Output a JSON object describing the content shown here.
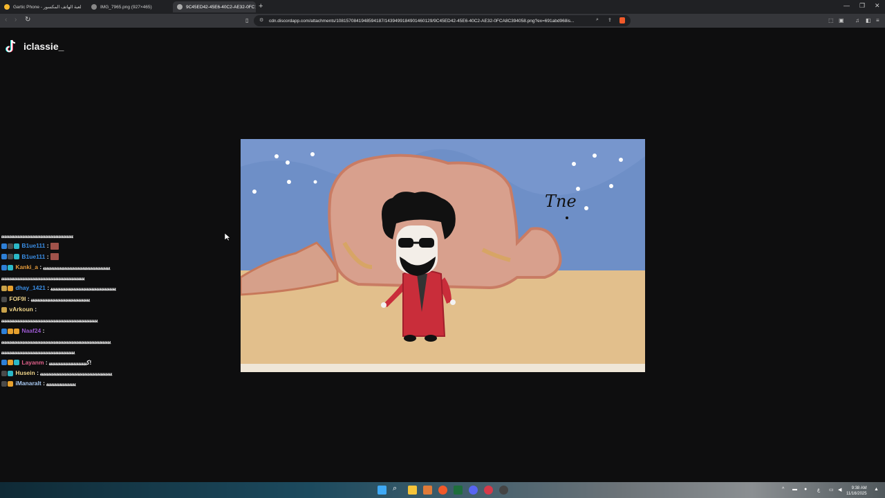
{
  "browser": {
    "tabs": [
      {
        "title": "Gartic Phone - لعبة الهاتف المكسور",
        "active": false
      },
      {
        "title": "IMG_7965.png (927×465)",
        "active": false
      },
      {
        "title": "9C45ED42-45E6-40C2-AE32-0FC",
        "active": true
      }
    ],
    "new_tab": "+",
    "url": "cdn.discordapp.com/attachments/1081570841948594187/1439499184901460129/9C45ED42-45E6-40C2-AE32-0FCA8C394058.png?ex=691abd968is..."
  },
  "stream": {
    "channel_name": "iclassie_"
  },
  "chat": [
    {
      "user": "",
      "color": "#ffffff",
      "badges": [],
      "message": "ﯾﯾﯾﯾﯾﯾﯾﯾﯾﯾﯾﯾﯾﯾﯾﯾﯾﯾﯾﯾﯾﯾﯾﯾﯾﯾﯾﯾﯾﯾﯾﯾﯾﯾﯾﯾﯾﯾﯾﯾﯾﯾﯾﯾ",
      "emote": false
    },
    {
      "user": "B1ue111",
      "color": "#3a8ee6",
      "badges": [
        "#2e7fd6",
        "#4a4a4a",
        "#2bb8c7"
      ],
      "message": "",
      "emote": true
    },
    {
      "user": "B1ue111",
      "color": "#3a8ee6",
      "badges": [
        "#2e7fd6",
        "#4a4a4a",
        "#2bb8c7"
      ],
      "message": "",
      "emote": true
    },
    {
      "user": "Kanki_a",
      "color": "#e39a3b",
      "badges": [
        "#2e7fd6",
        "#2bb8c7"
      ],
      "message": "ﯾﯾﯾﯾﯾﯾﯾﯾﯾﯾﯾﯾﯾﯾﯾﯾﯾﯾﯾﯾﯾﯾﯾﯾﯾﯾﯾﯾﯾﯾﯾﯾﯾﯾﯾﯾﯾﯾﯾﯾﯾ",
      "emote": false
    },
    {
      "user": "",
      "color": "#ffffff",
      "badges": [],
      "message": "ﯾﯾﯾﯾﯾﯾﯾﯾﯾﯾﯾﯾﯾﯾﯾﯾﯾﯾﯾﯾﯾﯾﯾﯾﯾﯾﯾﯾﯾﯾﯾﯾﯾﯾﯾﯾﯾﯾﯾﯾﯾﯾﯾﯾﯾﯾﯾﯾﯾﯾﯾ",
      "emote": false
    },
    {
      "user": "dhay_1421",
      "color": "#3a8ee6",
      "badges": [
        "#c9a24a",
        "#e6a02e"
      ],
      "message": "ﯾﯾﯾﯾﯾﯾﯾﯾﯾﯾﯾﯾﯾﯾﯾﯾﯾﯾﯾﯾﯾﯾﯾﯾﯾﯾﯾﯾﯾﯾﯾﯾﯾﯾﯾﯾﯾﯾﯾﯾ",
      "emote": false
    },
    {
      "user": "FOF9I",
      "color": "#f0d58a",
      "badges": [
        "#4a4a4a"
      ],
      "message": "ﯾﯾﯾﯾﯾﯾﯾﯾﯾﯾﯾﯾﯾﯾﯾﯾﯾﯾﯾﯾﯾﯾﯾﯾﯾﯾﯾﯾﯾﯾﯾﯾﯾﯾﯾﯾ",
      "emote": false
    },
    {
      "user": "vArkoun",
      "color": "#f0d58a",
      "badges": [
        "#c9a24a"
      ],
      "message": "",
      "emote": false
    },
    {
      "user": "",
      "color": "#ffffff",
      "badges": [],
      "message": "ﯾﯾﯾﯾﯾﯾﯾﯾﯾﯾﯾﯾﯾﯾﯾﯾﯾﯾﯾﯾﯾﯾﯾﯾﯾﯾﯾﯾﯾﯾﯾﯾﯾﯾﯾﯾﯾﯾﯾﯾﯾﯾﯾﯾﯾﯾﯾﯾﯾﯾﯾﯾﯾﯾﯾﯾﯾﯾﯾ",
      "emote": false
    },
    {
      "user": "Naaf24",
      "color": "#9b59d0",
      "badges": [
        "#2e7fd6",
        "#e6a02e",
        "#e6a02e"
      ],
      "message": "",
      "emote": false
    },
    {
      "user": "",
      "color": "#ffffff",
      "badges": [],
      "message": "ﯾﯾﯾﯾﯾﯾﯾﯾﯾﯾﯾﯾﯾﯾﯾﯾﯾﯾﯾﯾﯾﯾﯾﯾﯾﯾﯾﯾﯾﯾﯾﯾﯾﯾﯾﯾﯾﯾﯾﯾﯾﯾﯾﯾﯾﯾﯾﯾﯾﯾﯾﯾﯾﯾﯾﯾﯾﯾﯾﯾﯾﯾﯾﯾﯾﯾﯾ",
      "emote": false
    },
    {
      "user": "",
      "color": "#ffffff",
      "badges": [],
      "message": "ﯾﯾﯾﯾﯾﯾﯾﯾﯾﯾﯾﯾﯾﯾﯾﯾﯾﯾﯾﯾﯾﯾﯾﯾﯾﯾﯾﯾﯾﯾﯾﯾﯾﯾﯾﯾﯾﯾﯾﯾﯾﯾﯾﯾﯾ",
      "emote": false
    },
    {
      "user": "Layanm",
      "color": "#e0608a",
      "badges": [
        "#2e7fd6",
        "#e6a02e",
        "#2bb8c7"
      ],
      "message": "ﮐﯾﯾﯾﯾﯾﯾﯾﯾﯾﯾﯾﯾﯾﯾﯾﯾﯾﯾﯾﯾﯾﯾﯾ!",
      "emote": false
    },
    {
      "user": "Husein",
      "color": "#f0d58a",
      "badges": [
        "#4a4a4a",
        "#2bb8c7"
      ],
      "message": "ﯾﯾﯾﯾﯾﯾﯾﯾﯾﯾﯾﯾﯾﯾﯾﯾﯾﯾﯾﯾﯾﯾﯾﯾﯾﯾﯾﯾﯾﯾﯾﯾﯾﯾﯾﯾﯾﯾﯾﯾﯾﯾﯾﯾ",
      "emote": false
    },
    {
      "user": "iManaralt",
      "color": "#a8c8f0",
      "badges": [
        "#4a4a4a",
        "#e6a02e"
      ],
      "message": "ﯾﯾﯾﯾﯾﯾﯾﯾﯾﯾﯾﯾﯾﯾﯾﯾﯾﯾ",
      "emote": false
    }
  ],
  "drawing": {
    "scribble_text": "Tne"
  },
  "system": {
    "time": "9:38 AM",
    "date": "11/16/2025",
    "lang": "ع"
  }
}
